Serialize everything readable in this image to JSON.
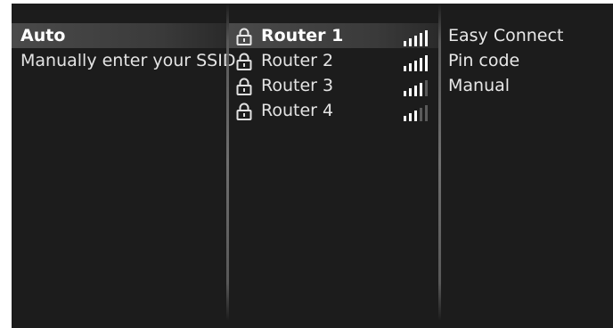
{
  "ssid_modes": [
    {
      "label": "Auto",
      "selected": true
    },
    {
      "label": "Manually enter your SSID",
      "selected": false
    }
  ],
  "routers": [
    {
      "name": "Router 1",
      "locked": true,
      "signal_bars": 5,
      "selected": true
    },
    {
      "name": "Router 2",
      "locked": true,
      "signal_bars": 5,
      "selected": false
    },
    {
      "name": "Router 3",
      "locked": true,
      "signal_bars": 4,
      "selected": false
    },
    {
      "name": "Router 4",
      "locked": true,
      "signal_bars": 3,
      "selected": false
    }
  ],
  "connection_methods": [
    {
      "label": "Easy Connect"
    },
    {
      "label": "Pin code"
    },
    {
      "label": "Manual"
    }
  ],
  "colors": {
    "background": "#1c1c1c",
    "text": "#e4e4e4",
    "selected_highlight": "#4a4a4a",
    "signal_active": "#ffffff",
    "signal_inactive": "#5a5a5a"
  }
}
